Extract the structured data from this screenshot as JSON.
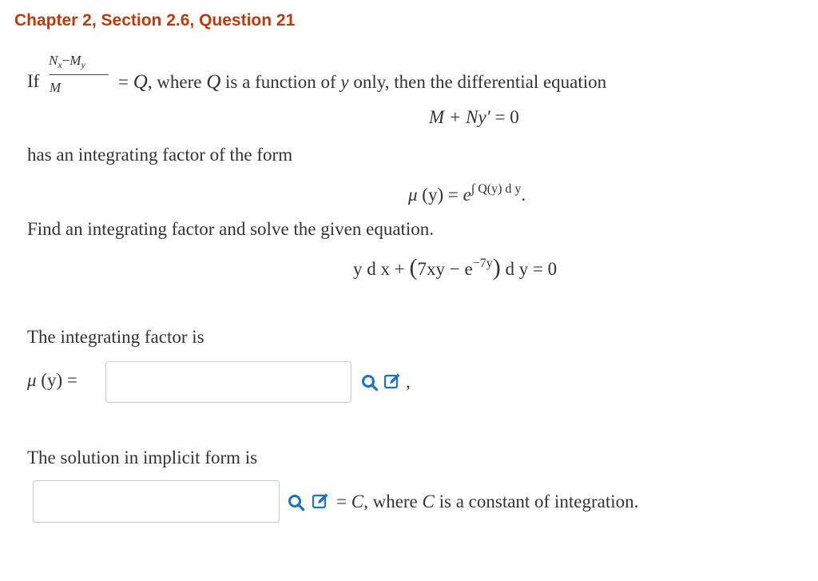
{
  "header": {
    "title": "Chapter 2, Section 2.6, Question 21"
  },
  "intro": {
    "if": "If",
    "frac_num_N": "N",
    "frac_num_sub_x": "x",
    "frac_num_minus": "−",
    "frac_num_M": "M",
    "frac_num_sub_y": "y",
    "frac_den": "M",
    "eq_Q": "= ",
    "Q": "Q",
    "where_text": ", where ",
    "Q2": "Q",
    "func_text": " is a function of ",
    "y": "y",
    "only_text": " only, then the differential equation"
  },
  "equation1": {
    "lhs": "M + Ny′",
    "rhs": " = 0"
  },
  "integrating_text": "has an integrating factor of the form",
  "formula": {
    "mu": "μ",
    "arg": " (y) = ",
    "e": "e",
    "exponent": "∫ Q(y) d y",
    "period": "."
  },
  "find_text": "Find an integrating factor and solve the given equation.",
  "equation2": {
    "part1": "y d x + ",
    "paren_open": "(",
    "inner": "7xy − e",
    "exp": "−7y",
    "paren_close": ")",
    "part2": " d y = 0"
  },
  "factor_label": "The integrating factor is",
  "factor_input": {
    "mu": "μ",
    "prefix": " (y) = ",
    "value": "",
    "suffix": ","
  },
  "solution_label": "The solution in implicit form is",
  "solution_input": {
    "value": "",
    "suffix_eq": "= ",
    "C": "C",
    "suffix_rest": ", where ",
    "C2": "C",
    "suffix_end": " is a constant of integration."
  },
  "colors": {
    "title": "#c0390b",
    "icon": "#1a73c8"
  },
  "icons": [
    "search-icon",
    "edit-icon"
  ]
}
